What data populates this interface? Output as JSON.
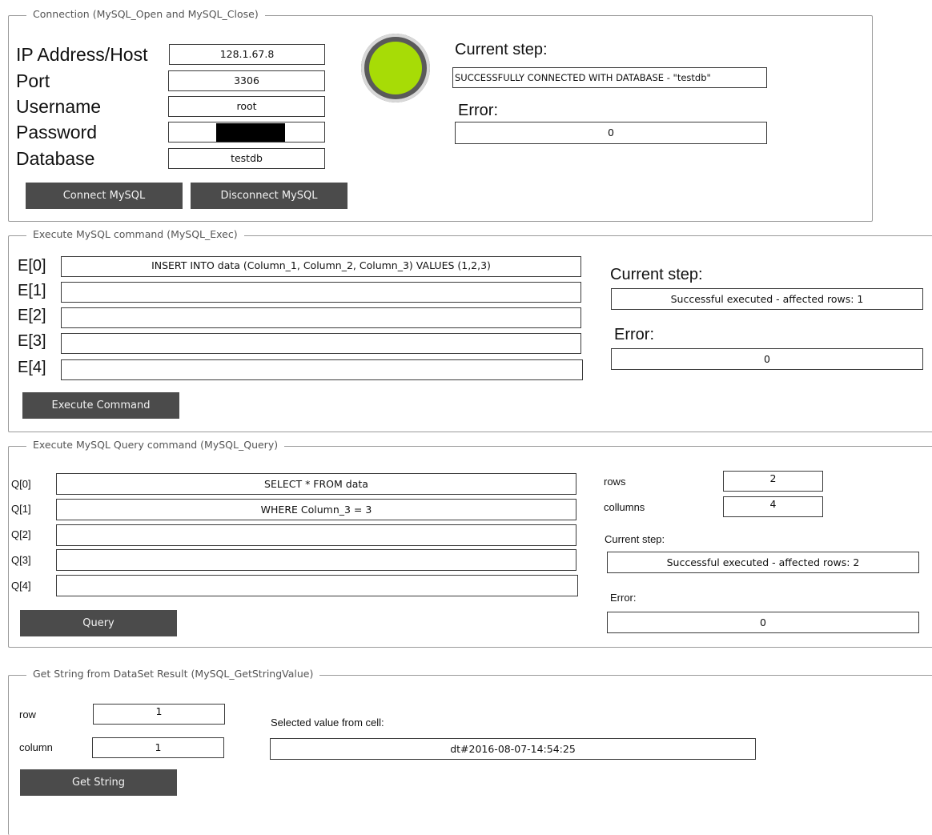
{
  "connection": {
    "title": "Connection (MySQL_Open and MySQL_Close)",
    "labels": {
      "host": "IP Address/Host",
      "port": "Port",
      "username": "Username",
      "password": "Password",
      "database": "Database"
    },
    "values": {
      "host": "128.1.67.8",
      "port": "3306",
      "username": "root",
      "database": "testdb"
    },
    "status_led_color": "#a7dc06",
    "current_step_label": "Current step:",
    "current_step_value": "SUCCESSFULLY CONNECTED WITH DATABASE - \"testdb\"",
    "error_label": "Error:",
    "error_value": "0",
    "connect_button": "Connect MySQL",
    "disconnect_button": "Disconnect MySQL"
  },
  "exec": {
    "title": "Execute MySQL command (MySQL_Exec)",
    "commands": [
      {
        "label": "E[0]",
        "value": "INSERT INTO data (Column_1, Column_2, Column_3) VALUES (1,2,3)"
      },
      {
        "label": "E[1]",
        "value": ""
      },
      {
        "label": "E[2]",
        "value": ""
      },
      {
        "label": "E[3]",
        "value": ""
      },
      {
        "label": "E[4]",
        "value": ""
      }
    ],
    "current_step_label": "Current step:",
    "current_step_value": "Successful executed - affected rows: 1",
    "error_label": "Error:",
    "error_value": "0",
    "execute_button": "Execute Command"
  },
  "query": {
    "title": "Execute MySQL Query command (MySQL_Query)",
    "queries": [
      {
        "label": "Q[0]",
        "value": "SELECT * FROM data"
      },
      {
        "label": "Q[1]",
        "value": "WHERE Column_3 = 3"
      },
      {
        "label": "Q[2]",
        "value": ""
      },
      {
        "label": "Q[3]",
        "value": ""
      },
      {
        "label": "Q[4]",
        "value": ""
      }
    ],
    "rows_label": "rows",
    "rows_value": "2",
    "columns_label": "collumns",
    "columns_value": "4",
    "current_step_label": "Current step:",
    "current_step_value": "Successful executed - affected rows: 2",
    "error_label": "Error:",
    "error_value": "0",
    "query_button": "Query"
  },
  "getstring": {
    "title": "Get String from DataSet Result (MySQL_GetStringValue)",
    "row_label": "row",
    "row_value": "1",
    "column_label": "column",
    "column_value": "1",
    "selected_label": "Selected value from cell:",
    "selected_value": "dt#2016-08-07-14:54:25",
    "get_button": "Get String"
  }
}
